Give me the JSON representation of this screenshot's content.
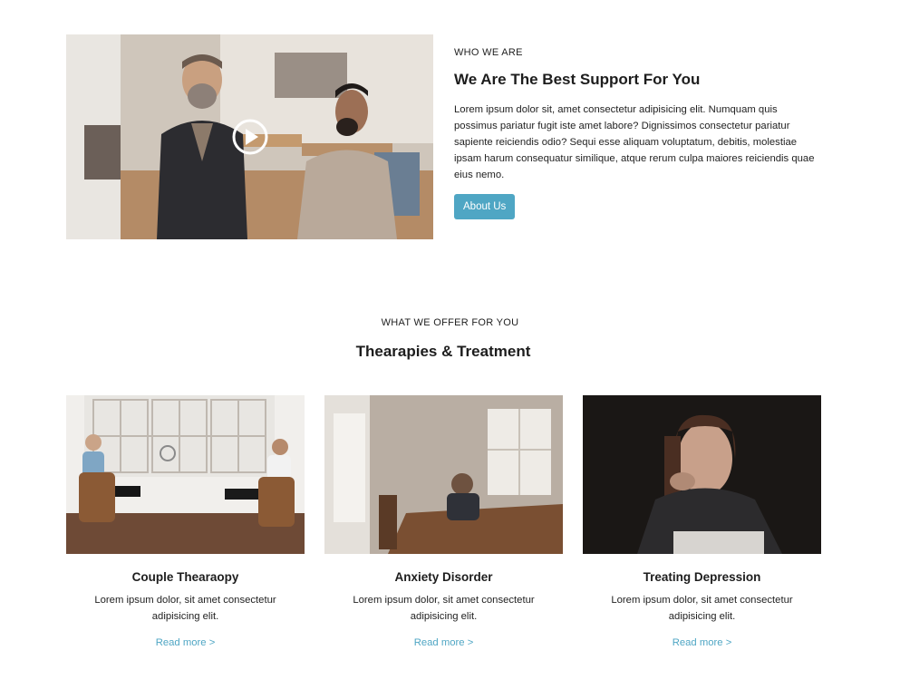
{
  "about": {
    "eyebrow": "WHO WE ARE",
    "title": "We Are The Best Support For You",
    "body": "Lorem ipsum dolor sit, amet consectetur adipisicing elit. Numquam quis possimus pariatur fugit iste amet labore? Dignissimos consectetur pariatur sapiente reiciendis odio? Sequi esse aliquam voluptatum, debitis, molestiae ipsam harum consequatur similique, atque rerum culpa maiores reiciendis quae eius nemo.",
    "button_label": "About Us",
    "video_icon": "play-circle-icon"
  },
  "offer": {
    "eyebrow": "WHAT WE OFFER FOR YOU",
    "title": "Thearapies & Treatment",
    "cards": [
      {
        "title": "Couple Thearaopy",
        "text": "Lorem ipsum dolor, sit amet consectetur adipisicing elit.",
        "link": "Read more >"
      },
      {
        "title": "Anxiety Disorder",
        "text": "Lorem ipsum dolor, sit amet consectetur adipisicing elit.",
        "link": "Read more >"
      },
      {
        "title": "Treating Depression",
        "text": "Lorem ipsum dolor, sit amet consectetur adipisicing elit.",
        "link": "Read more >"
      }
    ]
  },
  "colors": {
    "accent": "#4fa6c4",
    "heading": "#1d1d1d",
    "text": "#222222"
  }
}
